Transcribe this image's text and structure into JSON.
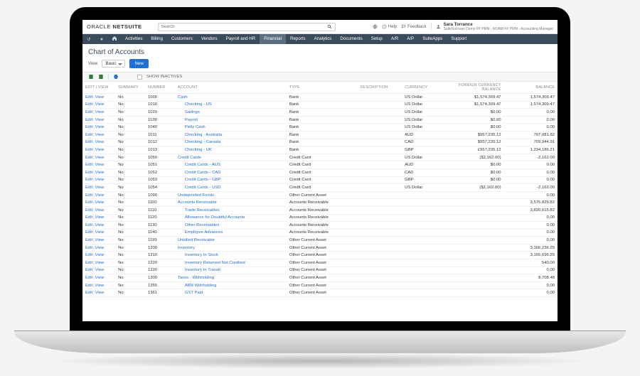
{
  "header": {
    "logo_prefix": "ORACLE",
    "logo_suffix": "NETSUITE",
    "search_placeholder": "Search",
    "help_label": "Help",
    "feedback_label": "Feedback",
    "user_name": "Sara Torrance",
    "user_role": "SuiteSuccess Demo FF PRM - NOAM FF PRM - Accounting Manager"
  },
  "nav": {
    "items": [
      "Activities",
      "Billing",
      "Customers",
      "Vendors",
      "Payroll and HR",
      "Financial",
      "Reports",
      "Analytics",
      "Documents",
      "Setup",
      "A/R",
      "A/P",
      "SuiteApps",
      "Support"
    ],
    "active_index": 5
  },
  "page": {
    "title": "Chart of Accounts",
    "view_label": "View",
    "view_value": "Basic",
    "new_button": "New",
    "show_inactives": "SHOW INACTIVES"
  },
  "columns": {
    "edit": "EDIT | VIEW",
    "summary": "SUMMARY",
    "number": "NUMBER",
    "account": "ACCOUNT",
    "type": "TYPE",
    "description": "DESCRIPTION",
    "currency": "CURRENCY",
    "fcb": "FOREIGN CURRENCY BALANCE",
    "balance": "BALANCE"
  },
  "row_labels": {
    "edit": "Edit",
    "view": "View"
  },
  "rows": [
    {
      "summary": "No",
      "number": "1000",
      "account": "Cash",
      "indent": 0,
      "type": "Bank",
      "currency": "US Dollar",
      "fcb": "$1,574,309.47",
      "balance": "1,574,309.47"
    },
    {
      "summary": "No",
      "number": "1010",
      "account": "Checking - US",
      "indent": 1,
      "type": "Bank",
      "currency": "US Dollar",
      "fcb": "$1,574,309.47",
      "balance": "1,574,309.47"
    },
    {
      "summary": "No",
      "number": "1020",
      "account": "Savings",
      "indent": 1,
      "type": "Bank",
      "currency": "US Dollar",
      "fcb": "$0.00",
      "balance": "0.00"
    },
    {
      "summary": "No",
      "number": "1030",
      "account": "Payroll",
      "indent": 1,
      "type": "Bank",
      "currency": "US Dollar",
      "fcb": "$0.00",
      "balance": "0.00"
    },
    {
      "summary": "No",
      "number": "1040",
      "account": "Petty Cash",
      "indent": 1,
      "type": "Bank",
      "currency": "US Dollar",
      "fcb": "$0.00",
      "balance": "0.00"
    },
    {
      "summary": "No",
      "number": "1011",
      "account": "Checking - Australia",
      "indent": 1,
      "type": "Bank",
      "currency": "AUD",
      "fcb": "$957,235.12",
      "balance": "707,081.82"
    },
    {
      "summary": "No",
      "number": "1012",
      "account": "Checking - Canada",
      "indent": 1,
      "type": "Bank",
      "currency": "CAD",
      "fcb": "$957,235.12",
      "balance": "709,944.91"
    },
    {
      "summary": "No",
      "number": "1013",
      "account": "Checking - UK",
      "indent": 1,
      "type": "Bank",
      "currency": "GBP",
      "fcb": "£957,235.12",
      "balance": "1,234,186.21"
    },
    {
      "summary": "No",
      "number": "1050",
      "account": "Credit Cards",
      "indent": 0,
      "type": "Credit Card",
      "currency": "US Dollar",
      "fcb": "($2,162.00)",
      "balance": "-2,162.00"
    },
    {
      "summary": "No",
      "number": "1051",
      "account": "Credit Cards - AUS",
      "indent": 1,
      "type": "Credit Card",
      "currency": "AUD",
      "fcb": "$0.00",
      "balance": "0.00"
    },
    {
      "summary": "No",
      "number": "1052",
      "account": "Credit Cards - CAD",
      "indent": 1,
      "type": "Credit Card",
      "currency": "CAD",
      "fcb": "$0.00",
      "balance": "0.00"
    },
    {
      "summary": "No",
      "number": "1053",
      "account": "Credit Cards - GBP",
      "indent": 1,
      "type": "Credit Card",
      "currency": "GBP",
      "fcb": "$0.00",
      "balance": "0.00"
    },
    {
      "summary": "No",
      "number": "1054",
      "account": "Credit Cards - USD",
      "indent": 1,
      "type": "Credit Card",
      "currency": "US Dollar",
      "fcb": "($2,162.00)",
      "balance": "-2,162.00"
    },
    {
      "summary": "No",
      "number": "1090",
      "account": "Undeposited Funds",
      "indent": 0,
      "type": "Other Current Asset",
      "currency": "",
      "fcb": "",
      "balance": "0.00"
    },
    {
      "summary": "No",
      "number": "1100",
      "account": "Accounts Receivable",
      "indent": 0,
      "type": "Accounts Receivable",
      "currency": "",
      "fcb": "",
      "balance": "3,575,829.82"
    },
    {
      "summary": "No",
      "number": "1110",
      "account": "Trade Receivables",
      "indent": 1,
      "type": "Accounts Receivable",
      "currency": "",
      "fcb": "",
      "balance": "3,820,615.82"
    },
    {
      "summary": "No",
      "number": "1120",
      "account": "Allowance for Doubtful Accounts",
      "indent": 1,
      "type": "Accounts Receivable",
      "currency": "",
      "fcb": "",
      "balance": "0.00"
    },
    {
      "summary": "No",
      "number": "1130",
      "account": "Other Receivables",
      "indent": 1,
      "type": "Accounts Receivable",
      "currency": "",
      "fcb": "",
      "balance": "0.00"
    },
    {
      "summary": "No",
      "number": "1140",
      "account": "Employee Advances",
      "indent": 1,
      "type": "Accounts Receivable",
      "currency": "",
      "fcb": "",
      "balance": "0.00"
    },
    {
      "summary": "No",
      "number": "1199",
      "account": "Unbilled Receivable",
      "indent": 0,
      "type": "Other Current Asset",
      "currency": "",
      "fcb": "",
      "balance": "0.00"
    },
    {
      "summary": "No",
      "number": "1200",
      "account": "Inventory",
      "indent": 0,
      "type": "Other Current Asset",
      "currency": "",
      "fcb": "",
      "balance": "3,166,236.25"
    },
    {
      "summary": "No",
      "number": "1210",
      "account": "Inventory In Stock",
      "indent": 1,
      "type": "Other Current Asset",
      "currency": "",
      "fcb": "",
      "balance": "3,165,696.25"
    },
    {
      "summary": "No",
      "number": "1220",
      "account": "Inventory Returned Not Credited",
      "indent": 1,
      "type": "Other Current Asset",
      "currency": "",
      "fcb": "",
      "balance": "540.00"
    },
    {
      "summary": "No",
      "number": "1230",
      "account": "Inventory In Transit",
      "indent": 1,
      "type": "Other Current Asset",
      "currency": "",
      "fcb": "",
      "balance": "0.00"
    },
    {
      "summary": "No",
      "number": "1300",
      "account": "Taxes - Withholding",
      "indent": 0,
      "type": "Other Current Asset",
      "currency": "",
      "fcb": "",
      "balance": "8,708.48"
    },
    {
      "summary": "No",
      "number": "1355",
      "account": "ABN Withholding",
      "indent": 1,
      "type": "Other Current Asset",
      "currency": "",
      "fcb": "",
      "balance": "0.00"
    },
    {
      "summary": "No",
      "number": "1361",
      "account": "GST Paid",
      "indent": 1,
      "type": "Other Current Asset",
      "currency": "",
      "fcb": "",
      "balance": "0.00"
    }
  ]
}
